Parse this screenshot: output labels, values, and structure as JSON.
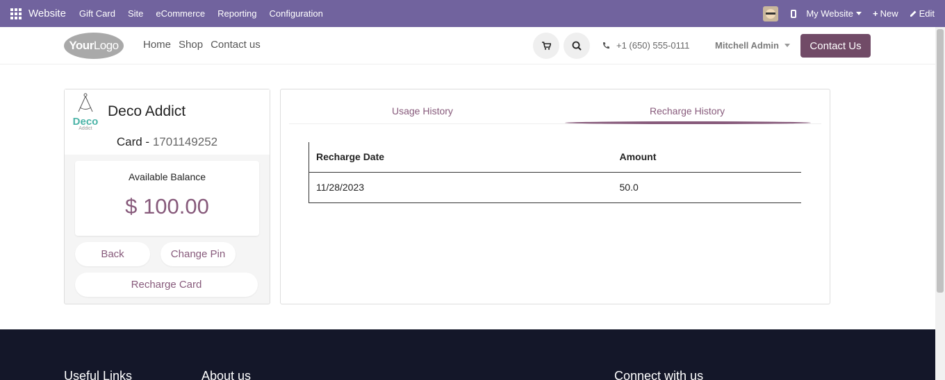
{
  "admin_bar": {
    "app_title": "Website",
    "menu": [
      "Gift Card",
      "Site",
      "eCommerce",
      "Reporting",
      "Configuration"
    ],
    "my_website": "My Website",
    "new": "New",
    "edit": "Edit",
    "color": "#71639e"
  },
  "header": {
    "logo_your": "Your",
    "logo_logo": "Logo",
    "nav": [
      "Home",
      "Shop",
      "Contact us"
    ],
    "phone": "+1 (650) 555-0111",
    "user": "Mitchell Admin",
    "contact_button": "Contact Us",
    "brand_color": "#714b67"
  },
  "card": {
    "partner_logo_word": "Deco",
    "partner_logo_sub": "Addict",
    "partner_name": "Deco Addict",
    "card_prefix": "Card - ",
    "card_number": "1701149252",
    "balance_label": "Available Balance",
    "balance_value": "$ 100.00",
    "back_button": "Back",
    "change_pin_button": "Change Pin",
    "recharge_button": "Recharge Card",
    "accent_color": "#875a7b"
  },
  "history": {
    "tabs": [
      "Usage History",
      "Recharge History"
    ],
    "active_tab": "Recharge History",
    "columns": [
      "Recharge Date",
      "Amount"
    ],
    "rows": [
      [
        "11/28/2023",
        "50.0"
      ]
    ]
  },
  "footer": {
    "headings": [
      "Useful Links",
      "About us",
      "Connect with us"
    ]
  }
}
